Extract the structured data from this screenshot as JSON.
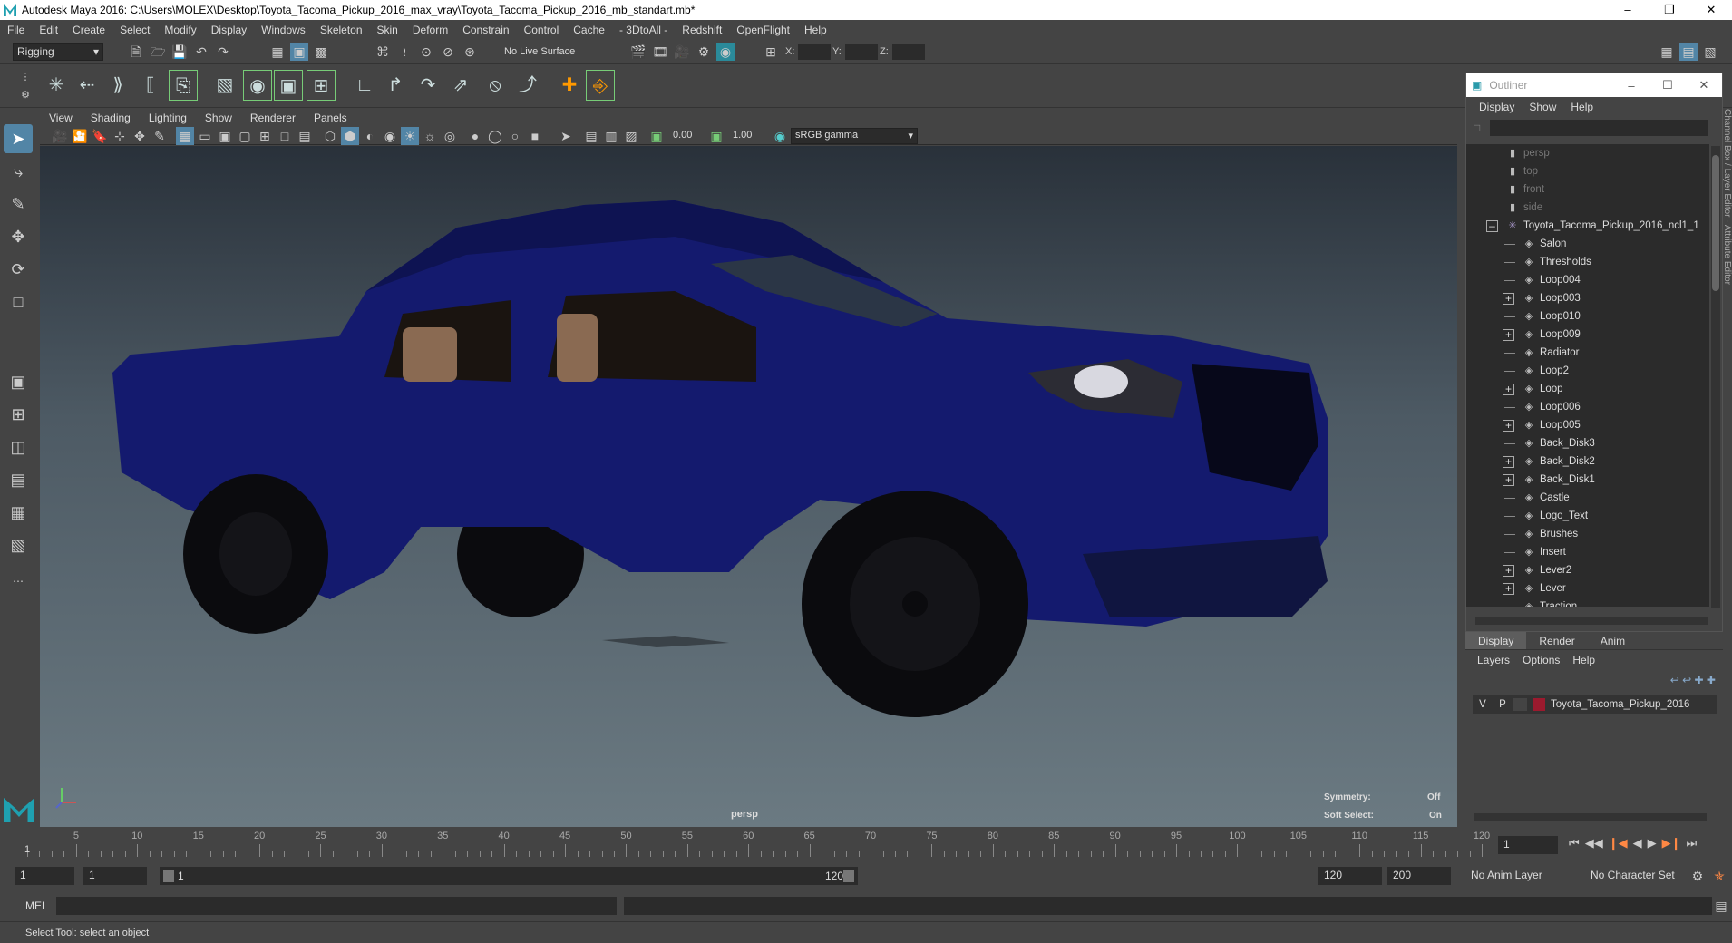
{
  "window": {
    "title": "Autodesk Maya 2016: C:\\Users\\MOLEX\\Desktop\\Toyota_Tacoma_Pickup_2016_max_vray\\Toyota_Tacoma_Pickup_2016_mb_standart.mb*"
  },
  "menu": [
    "File",
    "Edit",
    "Create",
    "Select",
    "Modify",
    "Display",
    "Windows",
    "Skeleton",
    "Skin",
    "Deform",
    "Constrain",
    "Control",
    "Cache",
    "- 3DtoAll -",
    "Redshift",
    "OpenFlight",
    "Help"
  ],
  "statusline": {
    "mode": "Rigging",
    "live_surface": "No Live Surface",
    "x_label": "X:",
    "y_label": "Y:",
    "z_label": "Z:"
  },
  "panel": {
    "menu": [
      "View",
      "Shading",
      "Lighting",
      "Show",
      "Renderer",
      "Panels"
    ],
    "exposure": "0.00",
    "gamma": "1.00",
    "colorspace": "sRGB gamma"
  },
  "viewport": {
    "camera_label": "persp",
    "symmetry_label": "Symmetry:",
    "symmetry_value": "Off",
    "soft_select_label": "Soft Select:",
    "soft_select_value": "On"
  },
  "outliner": {
    "title": "Outliner",
    "menu": [
      "Display",
      "Show",
      "Help"
    ],
    "cameras": [
      "persp",
      "top",
      "front",
      "side"
    ],
    "root": "Toyota_Tacoma_Pickup_2016_ncl1_1",
    "children": [
      {
        "name": "Salon",
        "expandable": false
      },
      {
        "name": "Thresholds",
        "expandable": false
      },
      {
        "name": "Loop004",
        "expandable": false
      },
      {
        "name": "Loop003",
        "expandable": true
      },
      {
        "name": "Loop010",
        "expandable": false
      },
      {
        "name": "Loop009",
        "expandable": true
      },
      {
        "name": "Radiator",
        "expandable": false
      },
      {
        "name": "Loop2",
        "expandable": false
      },
      {
        "name": "Loop",
        "expandable": true
      },
      {
        "name": "Loop006",
        "expandable": false
      },
      {
        "name": "Loop005",
        "expandable": true
      },
      {
        "name": "Back_Disk3",
        "expandable": false
      },
      {
        "name": "Back_Disk2",
        "expandable": true
      },
      {
        "name": "Back_Disk1",
        "expandable": true
      },
      {
        "name": "Castle",
        "expandable": false
      },
      {
        "name": "Logo_Text",
        "expandable": false
      },
      {
        "name": "Brushes",
        "expandable": false
      },
      {
        "name": "Insert",
        "expandable": false
      },
      {
        "name": "Lever2",
        "expandable": true
      },
      {
        "name": "Lever",
        "expandable": true
      },
      {
        "name": "Traction",
        "expandable": false
      }
    ]
  },
  "layers": {
    "tabs": [
      "Display",
      "Render",
      "Anim"
    ],
    "menu": [
      "Layers",
      "Options",
      "Help"
    ],
    "row": {
      "v": "V",
      "p": "P",
      "name": "Toyota_Tacoma_Pickup_2016",
      "color": "#9b1a2e"
    }
  },
  "timeline": {
    "ticks": [
      "5",
      "10",
      "15",
      "20",
      "25",
      "30",
      "35",
      "40",
      "45",
      "50",
      "55",
      "60",
      "65",
      "70",
      "75",
      "80",
      "85",
      "90",
      "95",
      "100",
      "105",
      "110",
      "115",
      "120"
    ],
    "start_marker": "1",
    "current_frame": "1"
  },
  "range": {
    "start": "1",
    "playback_start": "1",
    "slider_start": "1",
    "slider_end": "120",
    "playback_end": "120",
    "end": "200",
    "anim_layer": "No Anim Layer",
    "character_set": "No Character Set"
  },
  "cmdline": {
    "label": "MEL"
  },
  "helpline": {
    "text": "Select Tool: select an object"
  },
  "colors": {
    "truck_body": "#141a6e",
    "accent": "#5285a6"
  }
}
